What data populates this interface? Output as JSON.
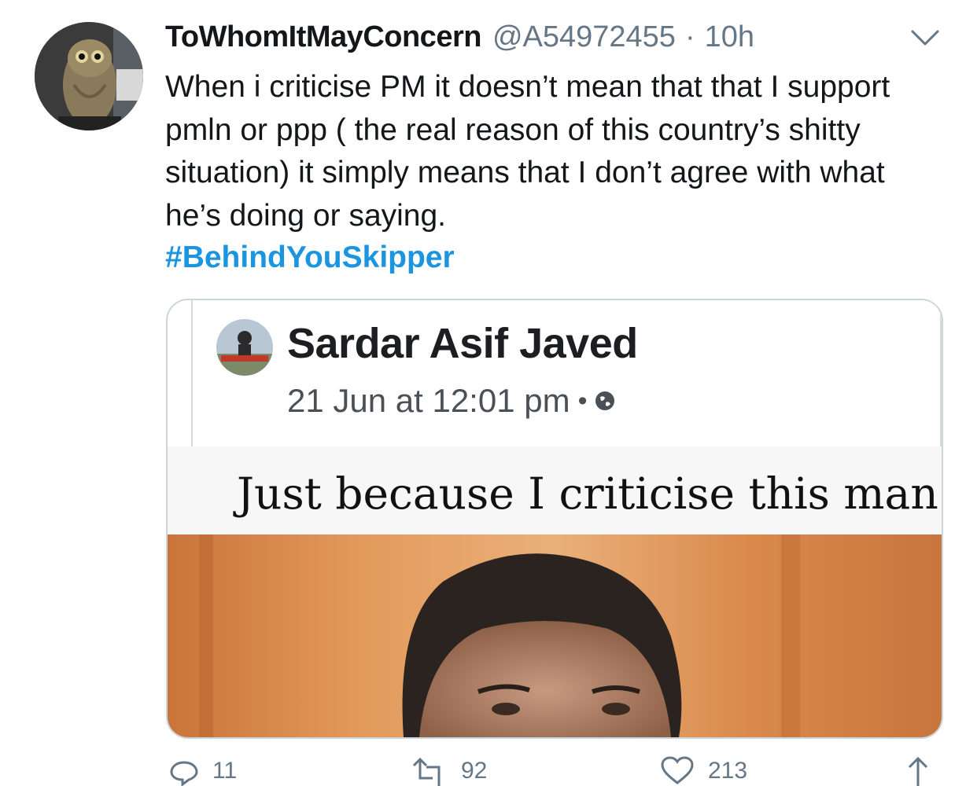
{
  "tweet": {
    "display_name": "ToWhomItMayConcern",
    "handle": "@A54972455",
    "separator": "·",
    "time": "10h",
    "text": "When i criticise PM it doesn’t mean that that I support pmln or ppp ( the real reason of this country’s shitty situation) it simply means that I don’t agree with what he’s doing or saying.",
    "hashtag": "#BehindYouSkipper",
    "avatar_icon": "owl-avatar",
    "menu_icon": "chevron-down-icon"
  },
  "embedded_post": {
    "author": "Sardar Asif Javed",
    "timestamp": "21 Jun at 12:01 pm",
    "dot": "•",
    "privacy_icon": "globe-icon",
    "caption": "Just because I criticise this man"
  },
  "actions": {
    "reply_count": "11",
    "retweet_count": "92",
    "like_count": "213"
  },
  "colors": {
    "hashtag": "#1b95e0",
    "muted": "#657786",
    "card_border": "#ccd6dd"
  }
}
